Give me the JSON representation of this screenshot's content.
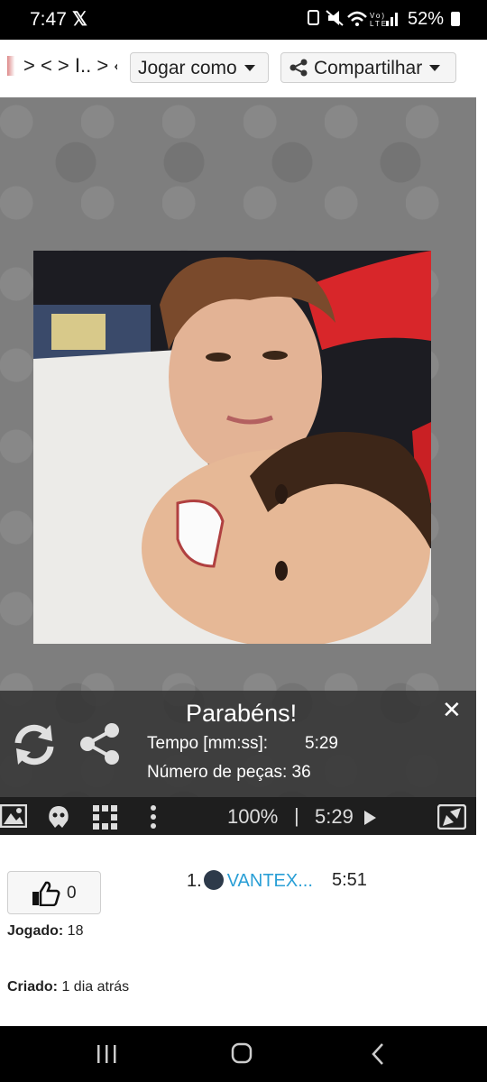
{
  "status_bar": {
    "time": "7:47",
    "battery": "52%"
  },
  "toolbar": {
    "breadcrumb": "> < > I.. > ‹",
    "play_as_label": "Jogar como",
    "share_label": "Compartilhar"
  },
  "completion": {
    "title": "Parabéns!",
    "time_label": "Tempo [mm:ss]:",
    "time_value": "5:29",
    "pieces_label": "Número de peças:",
    "pieces_value": "36"
  },
  "controls": {
    "zoom": "100%",
    "separator": "|",
    "timer": "5:29"
  },
  "likes": {
    "count": "0"
  },
  "stats": {
    "played_label": "Jogado:",
    "played_value": "18",
    "created_label": "Criado:",
    "created_value": "1 dia atrás"
  },
  "leaderboard": [
    {
      "rank": "1.",
      "name": "VANTEX...",
      "time": "5:51"
    }
  ],
  "colors": {
    "accent_link": "#2a9fd6",
    "panel": "#333333",
    "controls_bar": "#1e1e1e"
  }
}
